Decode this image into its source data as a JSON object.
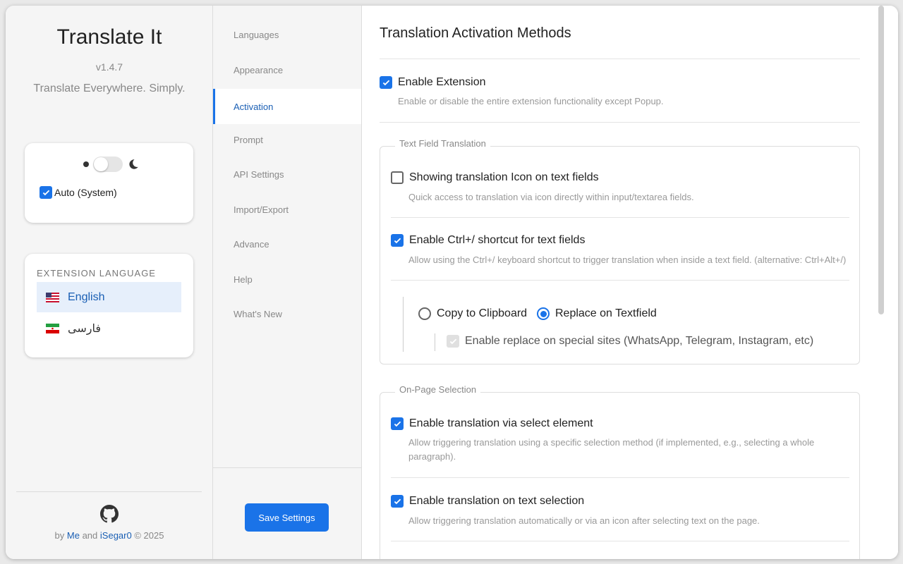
{
  "app": {
    "title": "Translate It",
    "version": "v1.4.7",
    "tagline": "Translate Everywhere. Simply."
  },
  "theme": {
    "auto_label": "Auto (System)",
    "auto_checked": true,
    "toggle_state": "light"
  },
  "extension_language": {
    "heading": "EXTENSION LANGUAGE",
    "items": [
      {
        "label": "English",
        "flag": "us-flag-icon",
        "selected": true
      },
      {
        "label": "فارسی",
        "flag": "iran-flag-icon",
        "selected": false
      }
    ]
  },
  "footer": {
    "by": "by",
    "me": "Me",
    "and": "and",
    "isegar": "iSegar0",
    "copyright": "© 2025"
  },
  "nav": {
    "items": [
      {
        "label": "Languages"
      },
      {
        "label": "Appearance"
      },
      {
        "label": "Activation",
        "active": true
      },
      {
        "label": "Prompt"
      },
      {
        "label": "API Settings"
      },
      {
        "label": "Import/Export"
      },
      {
        "label": "Advance"
      },
      {
        "label": "Help"
      },
      {
        "label": "What's New"
      }
    ],
    "save_label": "Save Settings"
  },
  "main": {
    "title": "Translation Activation Methods",
    "enable_extension": {
      "label": "Enable Extension",
      "desc": "Enable or disable the entire extension functionality except Popup.",
      "checked": true
    },
    "text_field": {
      "legend": "Text Field Translation",
      "icon_option": {
        "label": "Showing translation Icon on text fields",
        "desc": "Quick access to translation via icon directly within input/textarea fields.",
        "checked": false
      },
      "shortcut_option": {
        "label": "Enable Ctrl+/ shortcut for text fields",
        "desc": "Allow using the Ctrl+/ keyboard shortcut to trigger translation when inside a text field. (alternative: Ctrl+Alt+/)",
        "checked": true
      },
      "copy_label": "Copy to Clipboard",
      "replace_label": "Replace on Textfield",
      "selected_mode": "replace",
      "special_sites": {
        "label": "Enable replace on special sites (WhatsApp, Telegram, Instagram, etc)",
        "checked": true,
        "disabled": true
      }
    },
    "on_page": {
      "legend": "On-Page Selection",
      "select_element": {
        "label": "Enable translation via select element",
        "desc": "Allow triggering translation using a specific selection method (if implemented, e.g., selecting a whole paragraph).",
        "checked": true
      },
      "text_selection": {
        "label": "Enable translation on text selection",
        "desc": "Allow triggering translation automatically or via an icon after selecting text on the page.",
        "checked": true
      }
    }
  },
  "colors": {
    "accent": "#1a73e8",
    "link": "#1a5fb4"
  }
}
